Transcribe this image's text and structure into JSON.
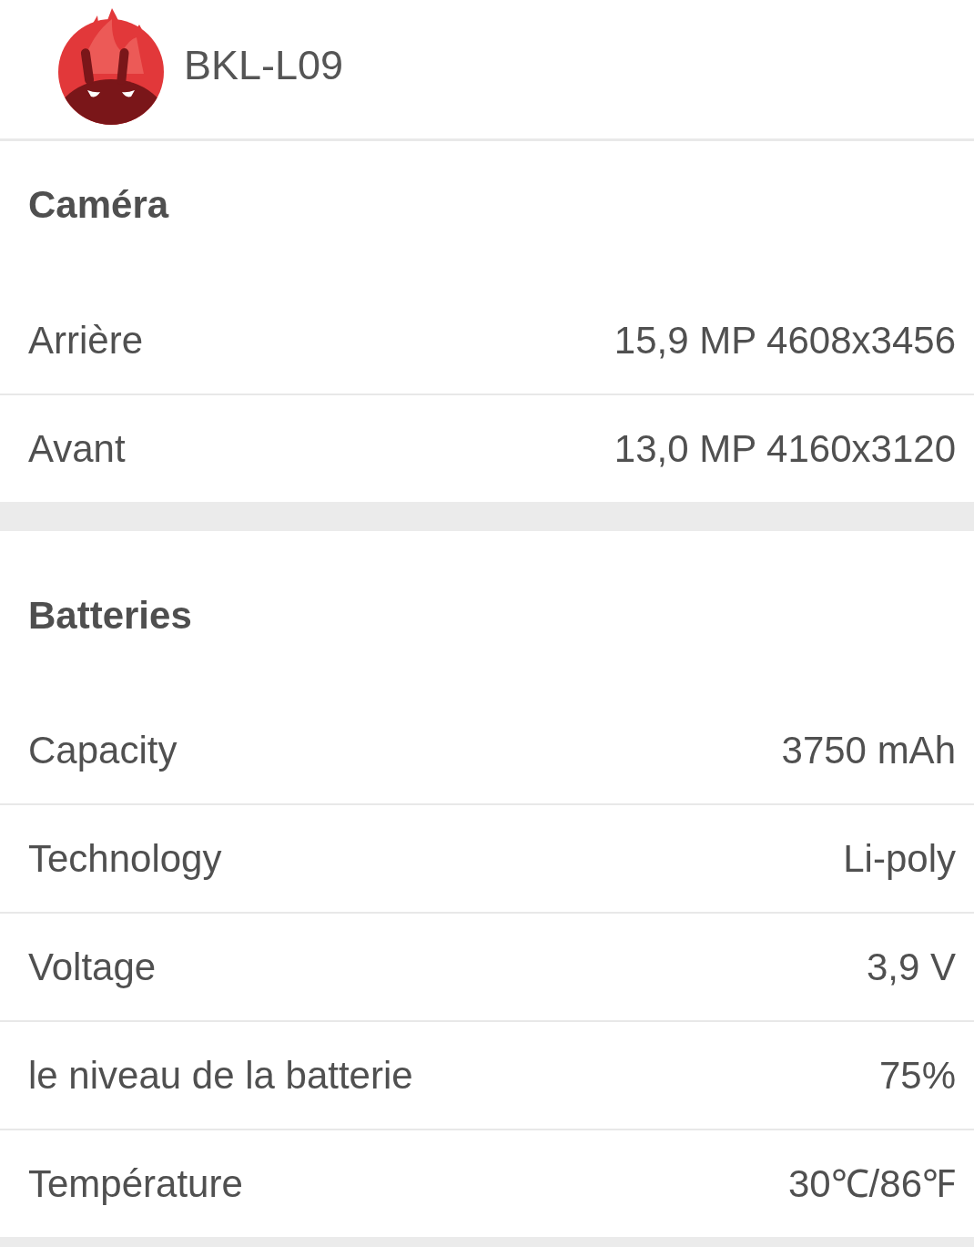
{
  "header": {
    "device_name": "BKL-L09"
  },
  "sections": [
    {
      "title": "Caméra",
      "rows": [
        {
          "label": "Arrière",
          "value": "15,9 MP 4608x3456"
        },
        {
          "label": "Avant",
          "value": "13,0 MP 4160x3120"
        }
      ]
    },
    {
      "title": "Batteries",
      "rows": [
        {
          "label": "Capacity",
          "value": "3750 mAh"
        },
        {
          "label": "Technology",
          "value": "Li-poly"
        },
        {
          "label": "Voltage",
          "value": "3,9 V"
        },
        {
          "label": "le niveau de la batterie",
          "value": "75%"
        },
        {
          "label": "Température",
          "value": "30℃/86℉"
        }
      ]
    }
  ]
}
